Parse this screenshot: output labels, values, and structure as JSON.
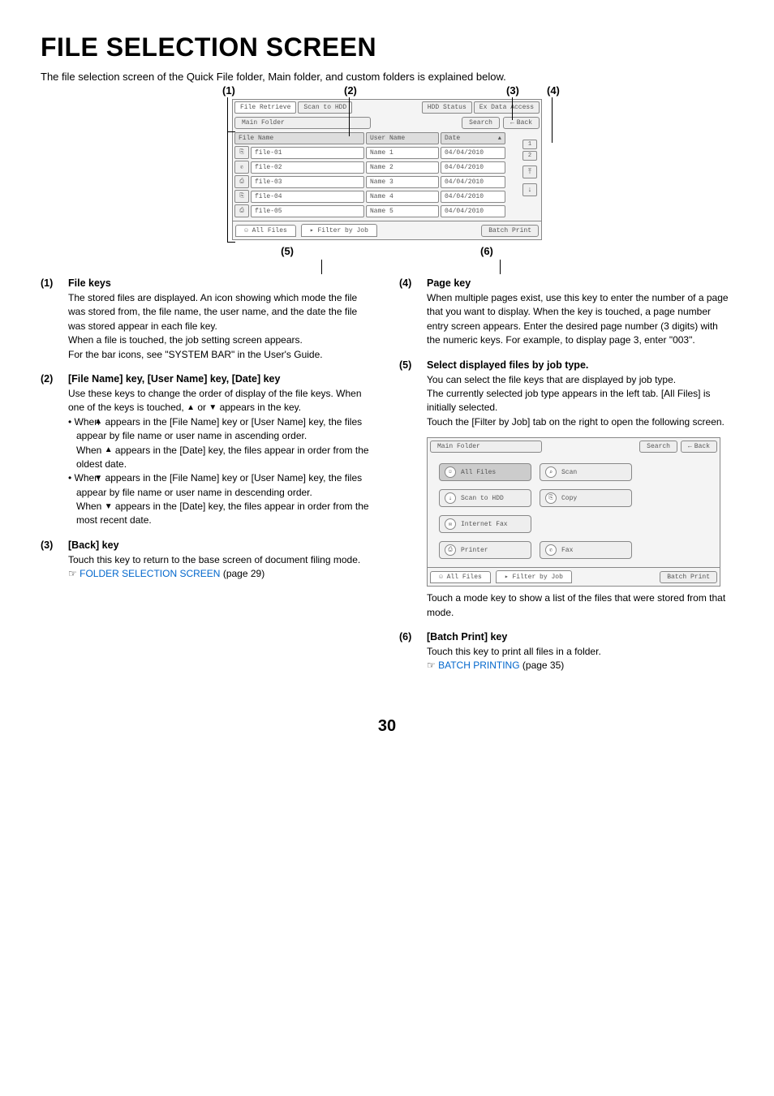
{
  "title": "FILE SELECTION SCREEN",
  "intro": "The file selection screen of the Quick File folder, Main folder, and custom folders is explained below.",
  "callouts": {
    "c1": "(1)",
    "c2": "(2)",
    "c3": "(3)",
    "c4": "(4)",
    "c5": "(5)",
    "c6": "(6)"
  },
  "panel": {
    "tab_retrieve": "File Retrieve",
    "tab_scan": "Scan to HDD",
    "hdd_status": "HDD Status",
    "ex_data": "Ex Data Access",
    "breadcrumb": "Main Folder",
    "search": "Search",
    "back": "Back",
    "hdr_file": "File Name",
    "hdr_user": "User Name",
    "hdr_date": "Date",
    "rows": [
      {
        "file": "file-01",
        "user": "Name 1",
        "date": "04/04/2010"
      },
      {
        "file": "file-02",
        "user": "Name 2",
        "date": "04/04/2010"
      },
      {
        "file": "file-03",
        "user": "Name 3",
        "date": "04/04/2010"
      },
      {
        "file": "file-04",
        "user": "Name 4",
        "date": "04/04/2010"
      },
      {
        "file": "file-05",
        "user": "Name 5",
        "date": "04/04/2010"
      }
    ],
    "page1": "1",
    "page2": "2",
    "all_files": "All Files",
    "filter_job": "Filter by Job",
    "batch_print": "Batch Print"
  },
  "left": {
    "i1_num": "(1)",
    "i1_title": "File keys",
    "i1_p1": "The stored files are displayed. An icon showing which mode the file was stored from, the file name, the user name, and the date the file was stored appear in each file key.",
    "i1_p2": "When a file is touched, the job setting screen appears.",
    "i1_p3": "For the bar icons, see \"SYSTEM BAR\" in the User's Guide.",
    "i2_num": "(2)",
    "i2_title": "[File Name] key, [User Name] key, [Date] key",
    "i2_p1a": "Use these keys to change the order of display of the file keys. When one of the keys is touched, ",
    "i2_p1b": " or ",
    "i2_p1c": " appears in the key.",
    "i2_b1a": "When ",
    "i2_b1b": " appears in the [File Name] key or [User Name] key, the files appear by file name or user name in ascending order.",
    "i2_b1c": "When ",
    "i2_b1d": " appears in the [Date] key, the files appear in order from the oldest date.",
    "i2_b2a": "When ",
    "i2_b2b": " appears in the [File Name] key or [User Name] key, the files appear by file name or user name in descending order.",
    "i2_b2c": "When ",
    "i2_b2d": " appears in the [Date] key, the files appear in order from the most recent date.",
    "i3_num": "(3)",
    "i3_title": "[Back] key",
    "i3_p1": "Touch this key to return to the base screen of document filing mode.",
    "i3_link_pre": "☞",
    "i3_link": "FOLDER SELECTION SCREEN",
    "i3_link_post": " (page 29)"
  },
  "right": {
    "i4_num": "(4)",
    "i4_title": "Page key",
    "i4_p1": "When multiple pages exist, use this key to enter the number of a page that you want to display. When the key is touched, a page number entry screen appears. Enter the desired page number (3 digits) with the numeric keys. For example, to display page 3, enter \"003\".",
    "i5_num": "(5)",
    "i5_title": "Select displayed files by job type.",
    "i5_p1": "You can select the file keys that are displayed by job type.",
    "i5_p2": "The currently selected job type appears in the left tab. [All Files] is initially selected.",
    "i5_p3": "Touch the [Filter by Job] tab on the right to open the following screen.",
    "i5_p4": "Touch a mode key to show a list of the files that were stored from that mode.",
    "i6_num": "(6)",
    "i6_title": "[Batch Print] key",
    "i6_p1": "Touch this key to print all files in a folder.",
    "i6_link_pre": "☞",
    "i6_link": "BATCH PRINTING",
    "i6_link_post": " (page 35)"
  },
  "panel2": {
    "breadcrumb": "Main Folder",
    "search": "Search",
    "back": "Back",
    "m_all": "All Files",
    "m_scan": "Scan",
    "m_hdd": "Scan to HDD",
    "m_copy": "Copy",
    "m_ifax": "Internet Fax",
    "m_printer": "Printer",
    "m_fax": "Fax",
    "all_files": "All Files",
    "filter_job": "Filter by Job",
    "batch_print": "Batch Print"
  },
  "page_number": "30"
}
